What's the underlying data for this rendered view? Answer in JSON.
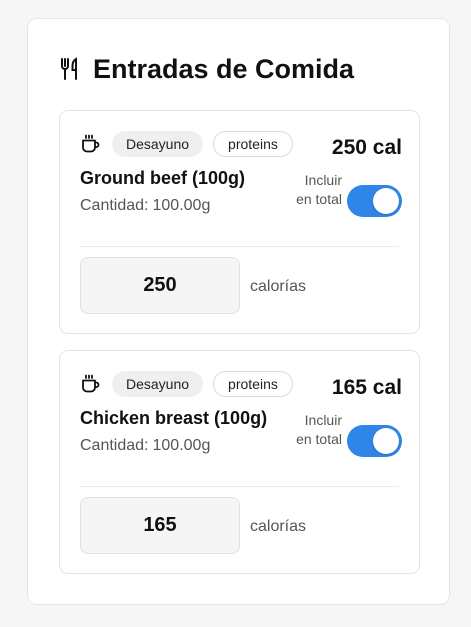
{
  "panel": {
    "title": "Entradas de Comida",
    "icon": "utensils-icon"
  },
  "entries": [
    {
      "meal_icon": "coffee-cup-icon",
      "meal": "Desayuno",
      "category": "proteins",
      "calories_label": "250 cal",
      "name": "Ground beef (100g)",
      "quantity_label": "Cantidad:",
      "quantity_value": "100.00g",
      "include_label": "Incluir en total",
      "include_on": true,
      "calories_value": "250",
      "calories_unit": "calorías"
    },
    {
      "meal_icon": "coffee-cup-icon",
      "meal": "Desayuno",
      "category": "proteins",
      "calories_label": "165 cal",
      "name": "Chicken breast (100g)",
      "quantity_label": "Cantidad:",
      "quantity_value": "100.00g",
      "include_label": "Incluir en total",
      "include_on": true,
      "calories_value": "165",
      "calories_unit": "calorías"
    }
  ],
  "colors": {
    "toggle_on": "#2f86e8",
    "meal_tag_bg": "#efefef",
    "card_border": "#e4e4e7"
  }
}
